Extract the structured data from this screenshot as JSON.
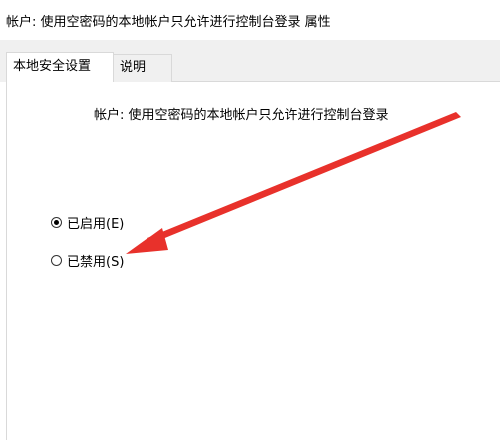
{
  "window": {
    "title": "帐户: 使用空密码的本地帐户只允许进行控制台登录 属性"
  },
  "tabs": [
    {
      "label": "本地安全设置",
      "active": true
    },
    {
      "label": "说明",
      "active": false
    }
  ],
  "policy": {
    "icon": "server-policy-icon",
    "name": "帐户: 使用空密码的本地帐户只允许进行控制台登录"
  },
  "options": {
    "enabled": {
      "label": "已启用(E)",
      "checked": true
    },
    "disabled": {
      "label": "已禁用(S)",
      "checked": false
    }
  },
  "annotation": {
    "icon": "red-arrow",
    "color": "#e8312b"
  }
}
